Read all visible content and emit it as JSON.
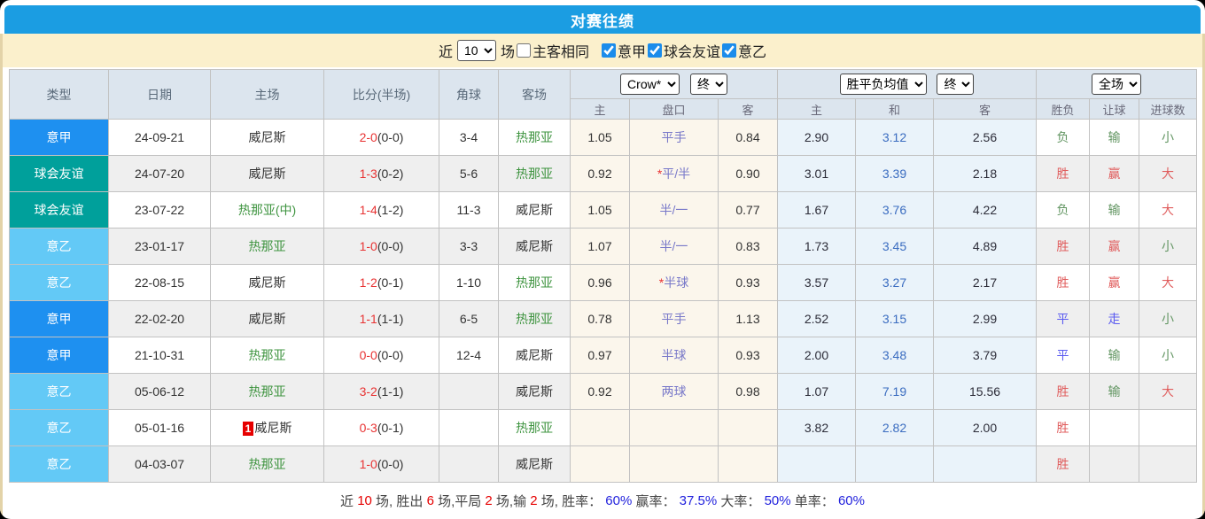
{
  "title": "对赛往绩",
  "palette": {
    "title_bar": "#1b9de2",
    "filter_bar_bg": "#fbf0cc",
    "league_seriea": "#1e90f0",
    "league_friendly": "#00a09b",
    "league_serieb": "#63c9f6",
    "handicap_cell_bg": "#fbf6ec",
    "euro_cell_bg": "#eaf3fa",
    "win_red": "#e05d5d",
    "lose_green": "#639663",
    "draw_blue": "#5c5cf0"
  },
  "filter": {
    "near_label": "近",
    "count_value": "10",
    "games_label": "场",
    "same_venue": {
      "label": "主客相同",
      "checked": false
    },
    "leagues": [
      {
        "label": "意甲",
        "checked": true
      },
      {
        "label": "球会友谊",
        "checked": true
      },
      {
        "label": "意乙",
        "checked": true
      }
    ]
  },
  "table": {
    "static_headers": [
      "类型",
      "日期",
      "主场",
      "比分(半场)",
      "角球",
      "客场"
    ],
    "group1": {
      "company": "Crow*",
      "time": "终"
    },
    "group2": {
      "company": "胜平负均值",
      "time": "终"
    },
    "group3": {
      "scope": "全场"
    },
    "sub_headers": [
      "主",
      "盘口",
      "客",
      "主",
      "和",
      "客",
      "胜负",
      "让球",
      "进球数"
    ],
    "rows": [
      {
        "type": "意甲",
        "league": "seriea",
        "date": "24-09-21",
        "home": "威尼斯",
        "home_color": "team-dark",
        "home_badge": "",
        "score": "2-0",
        "half": "(0-0)",
        "corner": "3-4",
        "away": "热那亚",
        "away_color": "team-green",
        "ah_home": "1.05",
        "ah_star": "",
        "ah_line": "平手",
        "ah_away": "0.84",
        "eu_home": "2.90",
        "eu_draw": "3.12",
        "eu_away": "2.56",
        "result": "负",
        "result_color": "green",
        "handicap": "输",
        "handicap_color": "green",
        "goals": "小",
        "goals_color": "green"
      },
      {
        "type": "球会友谊",
        "league": "friendly",
        "date": "24-07-20",
        "home": "威尼斯",
        "home_color": "team-dark",
        "home_badge": "",
        "score": "1-3",
        "half": "(0-2)",
        "corner": "5-6",
        "away": "热那亚",
        "away_color": "team-green",
        "ah_home": "0.92",
        "ah_star": "*",
        "ah_line": "平/半",
        "ah_away": "0.90",
        "eu_home": "3.01",
        "eu_draw": "3.39",
        "eu_away": "2.18",
        "result": "胜",
        "result_color": "red",
        "handicap": "赢",
        "handicap_color": "red",
        "goals": "大",
        "goals_color": "red"
      },
      {
        "type": "球会友谊",
        "league": "friendly",
        "date": "23-07-22",
        "home": "热那亚(中)",
        "home_color": "team-green",
        "home_badge": "",
        "score": "1-4",
        "half": "(1-2)",
        "corner": "11-3",
        "away": "威尼斯",
        "away_color": "team-dark",
        "ah_home": "1.05",
        "ah_star": "",
        "ah_line": "半/一",
        "ah_away": "0.77",
        "eu_home": "1.67",
        "eu_draw": "3.76",
        "eu_away": "4.22",
        "result": "负",
        "result_color": "green",
        "handicap": "输",
        "handicap_color": "green",
        "goals": "大",
        "goals_color": "red"
      },
      {
        "type": "意乙",
        "league": "serieb",
        "date": "23-01-17",
        "home": "热那亚",
        "home_color": "team-green",
        "home_badge": "",
        "score": "1-0",
        "half": "(0-0)",
        "corner": "3-3",
        "away": "威尼斯",
        "away_color": "team-dark",
        "ah_home": "1.07",
        "ah_star": "",
        "ah_line": "半/一",
        "ah_away": "0.83",
        "eu_home": "1.73",
        "eu_draw": "3.45",
        "eu_away": "4.89",
        "result": "胜",
        "result_color": "red",
        "handicap": "赢",
        "handicap_color": "red",
        "goals": "小",
        "goals_color": "green"
      },
      {
        "type": "意乙",
        "league": "serieb",
        "date": "22-08-15",
        "home": "威尼斯",
        "home_color": "team-dark",
        "home_badge": "",
        "score": "1-2",
        "half": "(0-1)",
        "corner": "1-10",
        "away": "热那亚",
        "away_color": "team-green",
        "ah_home": "0.96",
        "ah_star": "*",
        "ah_line": "半球",
        "ah_away": "0.93",
        "eu_home": "3.57",
        "eu_draw": "3.27",
        "eu_away": "2.17",
        "result": "胜",
        "result_color": "red",
        "handicap": "赢",
        "handicap_color": "red",
        "goals": "大",
        "goals_color": "red"
      },
      {
        "type": "意甲",
        "league": "seriea",
        "date": "22-02-20",
        "home": "威尼斯",
        "home_color": "team-dark",
        "home_badge": "",
        "score": "1-1",
        "half": "(1-1)",
        "corner": "6-5",
        "away": "热那亚",
        "away_color": "team-green",
        "ah_home": "0.78",
        "ah_star": "",
        "ah_line": "平手",
        "ah_away": "1.13",
        "eu_home": "2.52",
        "eu_draw": "3.15",
        "eu_away": "2.99",
        "result": "平",
        "result_color": "blue",
        "handicap": "走",
        "handicap_color": "blue",
        "goals": "小",
        "goals_color": "green"
      },
      {
        "type": "意甲",
        "league": "seriea",
        "date": "21-10-31",
        "home": "热那亚",
        "home_color": "team-green",
        "home_badge": "",
        "score": "0-0",
        "half": "(0-0)",
        "corner": "12-4",
        "away": "威尼斯",
        "away_color": "team-dark",
        "ah_home": "0.97",
        "ah_star": "",
        "ah_line": "半球",
        "ah_away": "0.93",
        "eu_home": "2.00",
        "eu_draw": "3.48",
        "eu_away": "3.79",
        "result": "平",
        "result_color": "blue",
        "handicap": "输",
        "handicap_color": "green",
        "goals": "小",
        "goals_color": "green"
      },
      {
        "type": "意乙",
        "league": "serieb",
        "date": "05-06-12",
        "home": "热那亚",
        "home_color": "team-green",
        "home_badge": "",
        "score": "3-2",
        "half": "(1-1)",
        "corner": "",
        "away": "威尼斯",
        "away_color": "team-dark",
        "ah_home": "0.92",
        "ah_star": "",
        "ah_line": "两球",
        "ah_away": "0.98",
        "eu_home": "1.07",
        "eu_draw": "7.19",
        "eu_away": "15.56",
        "result": "胜",
        "result_color": "red",
        "handicap": "输",
        "handicap_color": "green",
        "goals": "大",
        "goals_color": "red"
      },
      {
        "type": "意乙",
        "league": "serieb",
        "date": "05-01-16",
        "home": "威尼斯",
        "home_color": "team-dark",
        "home_badge": "1",
        "score": "0-3",
        "half": "(0-1)",
        "corner": "",
        "away": "热那亚",
        "away_color": "team-green",
        "ah_home": "",
        "ah_star": "",
        "ah_line": "",
        "ah_away": "",
        "eu_home": "3.82",
        "eu_draw": "2.82",
        "eu_away": "2.00",
        "result": "胜",
        "result_color": "red",
        "handicap": "",
        "handicap_color": "",
        "goals": "",
        "goals_color": ""
      },
      {
        "type": "意乙",
        "league": "serieb",
        "date": "04-03-07",
        "home": "热那亚",
        "home_color": "team-green",
        "home_badge": "",
        "score": "1-0",
        "half": "(0-0)",
        "corner": "",
        "away": "威尼斯",
        "away_color": "team-dark",
        "ah_home": "",
        "ah_star": "",
        "ah_line": "",
        "ah_away": "",
        "eu_home": "",
        "eu_draw": "",
        "eu_away": "",
        "result": "胜",
        "result_color": "red",
        "handicap": "",
        "handicap_color": "",
        "goals": "",
        "goals_color": ""
      }
    ]
  },
  "footer": {
    "items": [
      {
        "text": "近 ",
        "color": "dark"
      },
      {
        "text": "10",
        "color": "red"
      },
      {
        "text": " 场, 胜出 ",
        "color": "dark"
      },
      {
        "text": "6",
        "color": "red"
      },
      {
        "text": " 场,平局 ",
        "color": "dark"
      },
      {
        "text": "2",
        "color": "red"
      },
      {
        "text": " 场,输 ",
        "color": "dark"
      },
      {
        "text": "2",
        "color": "red"
      },
      {
        "text": " 场, 胜率： ",
        "color": "dark"
      },
      {
        "text": "60%",
        "color": "blue"
      },
      {
        "text": " 赢率： ",
        "color": "dark"
      },
      {
        "text": "37.5%",
        "color": "blue"
      },
      {
        "text": " 大率： ",
        "color": "dark"
      },
      {
        "text": "50%",
        "color": "blue"
      },
      {
        "text": " 单率： ",
        "color": "dark"
      },
      {
        "text": "60%",
        "color": "blue"
      }
    ]
  }
}
